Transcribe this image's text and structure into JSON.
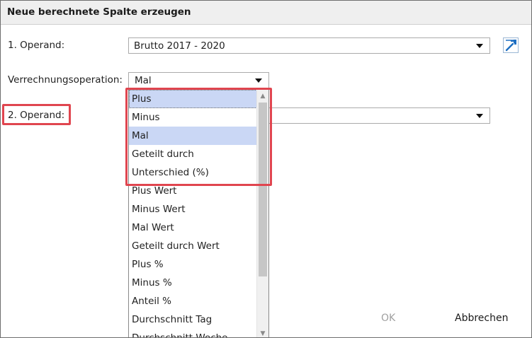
{
  "dialog": {
    "title": "Neue berechnete Spalte erzeugen",
    "operand1": {
      "label": "1. Operand:",
      "value": "Brutto 2017 - 2020"
    },
    "operation": {
      "label": "Verrechnungsoperation:",
      "value": "Mal"
    },
    "operand2": {
      "label": "2. Operand:",
      "value": ""
    },
    "edit_icon": "wrench-icon",
    "ok_label": "OK",
    "cancel_label": "Abbrechen"
  },
  "dropdown": {
    "items": [
      "Plus",
      "Minus",
      "Mal",
      "Geteilt durch",
      "Unterschied (%)",
      "Plus Wert",
      "Minus Wert",
      "Mal Wert",
      "Geteilt durch Wert",
      "Plus %",
      "Minus %",
      "Anteil %",
      "Durchschnitt Tag",
      "Durchschnitt Woche"
    ],
    "focused_item": "Plus",
    "selected_item": "Mal"
  },
  "colors": {
    "annotation": "#e0454f",
    "selection": "#cad7f5",
    "disabled_text": "#a0a0a0"
  }
}
